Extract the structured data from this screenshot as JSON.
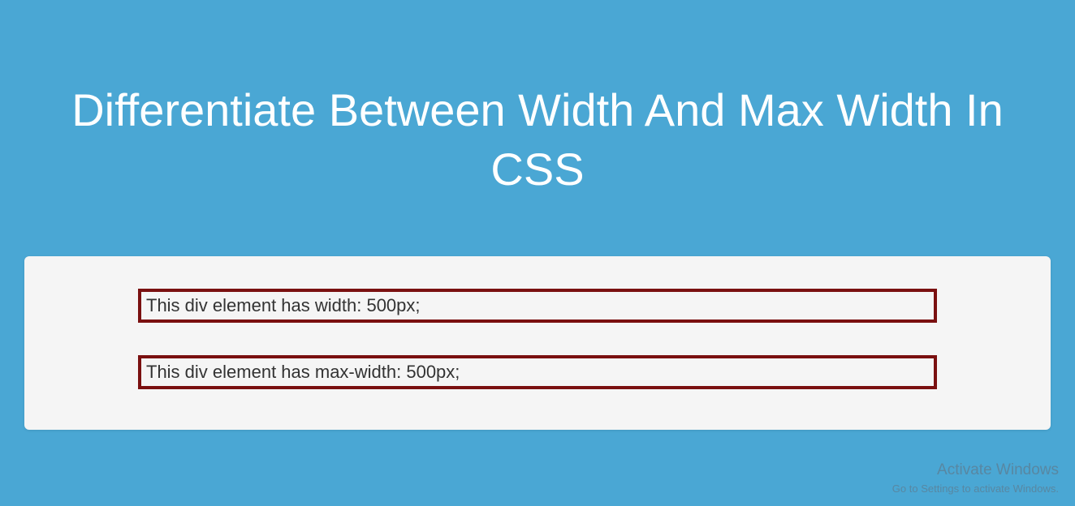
{
  "heading": "Differentiate Between Width And Max Width In CSS",
  "boxes": [
    {
      "text": "This div element has width: 500px;"
    },
    {
      "text": "This div element has max-width: 500px;"
    }
  ],
  "watermark": {
    "title": "Activate Windows",
    "subtitle": "Go to Settings to activate Windows."
  }
}
